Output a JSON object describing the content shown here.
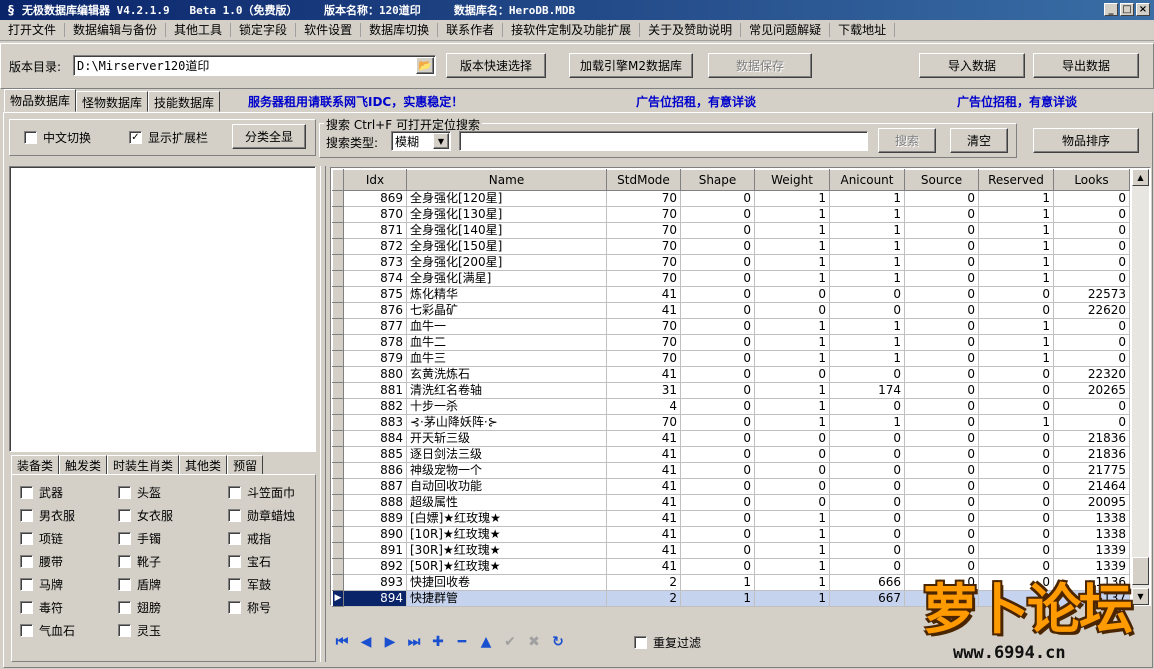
{
  "window": {
    "title": "无极数据库编辑器 V4.2.1.9   Beta 1.0（免费版）    版本名称：120道印     数据库名：HeroDB.MDB",
    "min": "_",
    "max": "□",
    "close": "×"
  },
  "menu": [
    "打开文件",
    "数据编辑与备份",
    "其他工具",
    "锁定字段",
    "软件设置",
    "数据库切换",
    "联系作者",
    "接软件定制及功能扩展",
    "关于及赞助说明",
    "常见问题解疑",
    "下载地址"
  ],
  "toolbar": {
    "version_dir_label": "版本目录:",
    "version_dir_value": "D:\\Mirserver120道印",
    "quick_select": "版本快速选择",
    "load_m2": "加载引擎M2数据库",
    "save_data": "数据保存",
    "import_data": "导入数据",
    "export_data": "导出数据"
  },
  "tabs": [
    "物品数据库",
    "怪物数据库",
    "技能数据库"
  ],
  "ads": {
    "server": "服务器租用请联系网飞IDC，实惠稳定！",
    "ad1": "广告位招租，有意详谈",
    "ad2": "广告位招租，有意详谈"
  },
  "options": {
    "chinese_switch": "中文切换",
    "show_ext": "显示扩展栏",
    "show_ext_checked": "✓",
    "category_all": "分类全显"
  },
  "search": {
    "header": "搜索  Ctrl+F 可打开定位搜索",
    "type_label": "搜索类型:",
    "type_value": "模糊",
    "search_btn": "搜索",
    "clear_btn": "清空",
    "sort_btn": "物品排序"
  },
  "category_tabs": [
    "装备类",
    "触发类",
    "时装生肖类",
    "其他类",
    "预留"
  ],
  "categories": [
    "武器",
    "头盔",
    "斗笠面巾",
    "男衣服",
    "女衣服",
    "勋章蜡烛",
    "项链",
    "手镯",
    "戒指",
    "腰带",
    "靴子",
    "宝石",
    "马牌",
    "盾牌",
    "军鼓",
    "毒符",
    "翅膀",
    "称号",
    "气血石",
    "灵玉"
  ],
  "grid": {
    "columns": [
      "Idx",
      "Name",
      "StdMode",
      "Shape",
      "Weight",
      "Anicount",
      "Source",
      "Reserved",
      "Looks"
    ],
    "rows": [
      [
        "869",
        "全身强化[120星]",
        "70",
        "0",
        "1",
        "1",
        "0",
        "1",
        "0"
      ],
      [
        "870",
        "全身强化[130星]",
        "70",
        "0",
        "1",
        "1",
        "0",
        "1",
        "0"
      ],
      [
        "871",
        "全身强化[140星]",
        "70",
        "0",
        "1",
        "1",
        "0",
        "1",
        "0"
      ],
      [
        "872",
        "全身强化[150星]",
        "70",
        "0",
        "1",
        "1",
        "0",
        "1",
        "0"
      ],
      [
        "873",
        "全身强化[200星]",
        "70",
        "0",
        "1",
        "1",
        "0",
        "1",
        "0"
      ],
      [
        "874",
        "全身强化[满星]",
        "70",
        "0",
        "1",
        "1",
        "0",
        "1",
        "0"
      ],
      [
        "875",
        "炼化精华",
        "41",
        "0",
        "0",
        "0",
        "0",
        "0",
        "22573"
      ],
      [
        "876",
        "七彩晶矿",
        "41",
        "0",
        "0",
        "0",
        "0",
        "0",
        "22620"
      ],
      [
        "877",
        "血牛一",
        "70",
        "0",
        "1",
        "1",
        "0",
        "1",
        "0"
      ],
      [
        "878",
        "血牛二",
        "70",
        "0",
        "1",
        "1",
        "0",
        "1",
        "0"
      ],
      [
        "879",
        "血牛三",
        "70",
        "0",
        "1",
        "1",
        "0",
        "1",
        "0"
      ],
      [
        "880",
        "玄黄洗炼石",
        "41",
        "0",
        "0",
        "0",
        "0",
        "0",
        "22320"
      ],
      [
        "881",
        "清洗红名卷轴",
        "31",
        "0",
        "1",
        "174",
        "0",
        "0",
        "20265"
      ],
      [
        "882",
        "十步一杀",
        "4",
        "0",
        "1",
        "0",
        "0",
        "0",
        "0"
      ],
      [
        "883",
        "⊰·茅山降妖阵·⊱",
        "70",
        "0",
        "1",
        "1",
        "0",
        "1",
        "0"
      ],
      [
        "884",
        "开天斩三级",
        "41",
        "0",
        "0",
        "0",
        "0",
        "0",
        "21836"
      ],
      [
        "885",
        "逐日剑法三级",
        "41",
        "0",
        "0",
        "0",
        "0",
        "0",
        "21836"
      ],
      [
        "886",
        "神级宠物一个",
        "41",
        "0",
        "0",
        "0",
        "0",
        "0",
        "21775"
      ],
      [
        "887",
        "自动回收功能",
        "41",
        "0",
        "0",
        "0",
        "0",
        "0",
        "21464"
      ],
      [
        "888",
        "超级属性",
        "41",
        "0",
        "0",
        "0",
        "0",
        "0",
        "20095"
      ],
      [
        "889",
        "[白嫖]★红玫瑰★",
        "41",
        "0",
        "1",
        "0",
        "0",
        "0",
        "1338"
      ],
      [
        "890",
        "[10R]★红玫瑰★",
        "41",
        "0",
        "1",
        "0",
        "0",
        "0",
        "1338"
      ],
      [
        "891",
        "[30R]★红玫瑰★",
        "41",
        "0",
        "1",
        "0",
        "0",
        "0",
        "1339"
      ],
      [
        "892",
        "[50R]★红玫瑰★",
        "41",
        "0",
        "1",
        "0",
        "0",
        "0",
        "1339"
      ],
      [
        "893",
        "快捷回收卷",
        "2",
        "1",
        "1",
        "666",
        "0",
        "0",
        "1136"
      ],
      [
        "894",
        "快捷群管",
        "2",
        "1",
        "1",
        "667",
        "0",
        "0",
        "1137"
      ]
    ]
  },
  "nav": {
    "repeat_filter": "重复过滤"
  },
  "logo": {
    "text": "萝卜论坛",
    "url": "www.6994.cn"
  }
}
